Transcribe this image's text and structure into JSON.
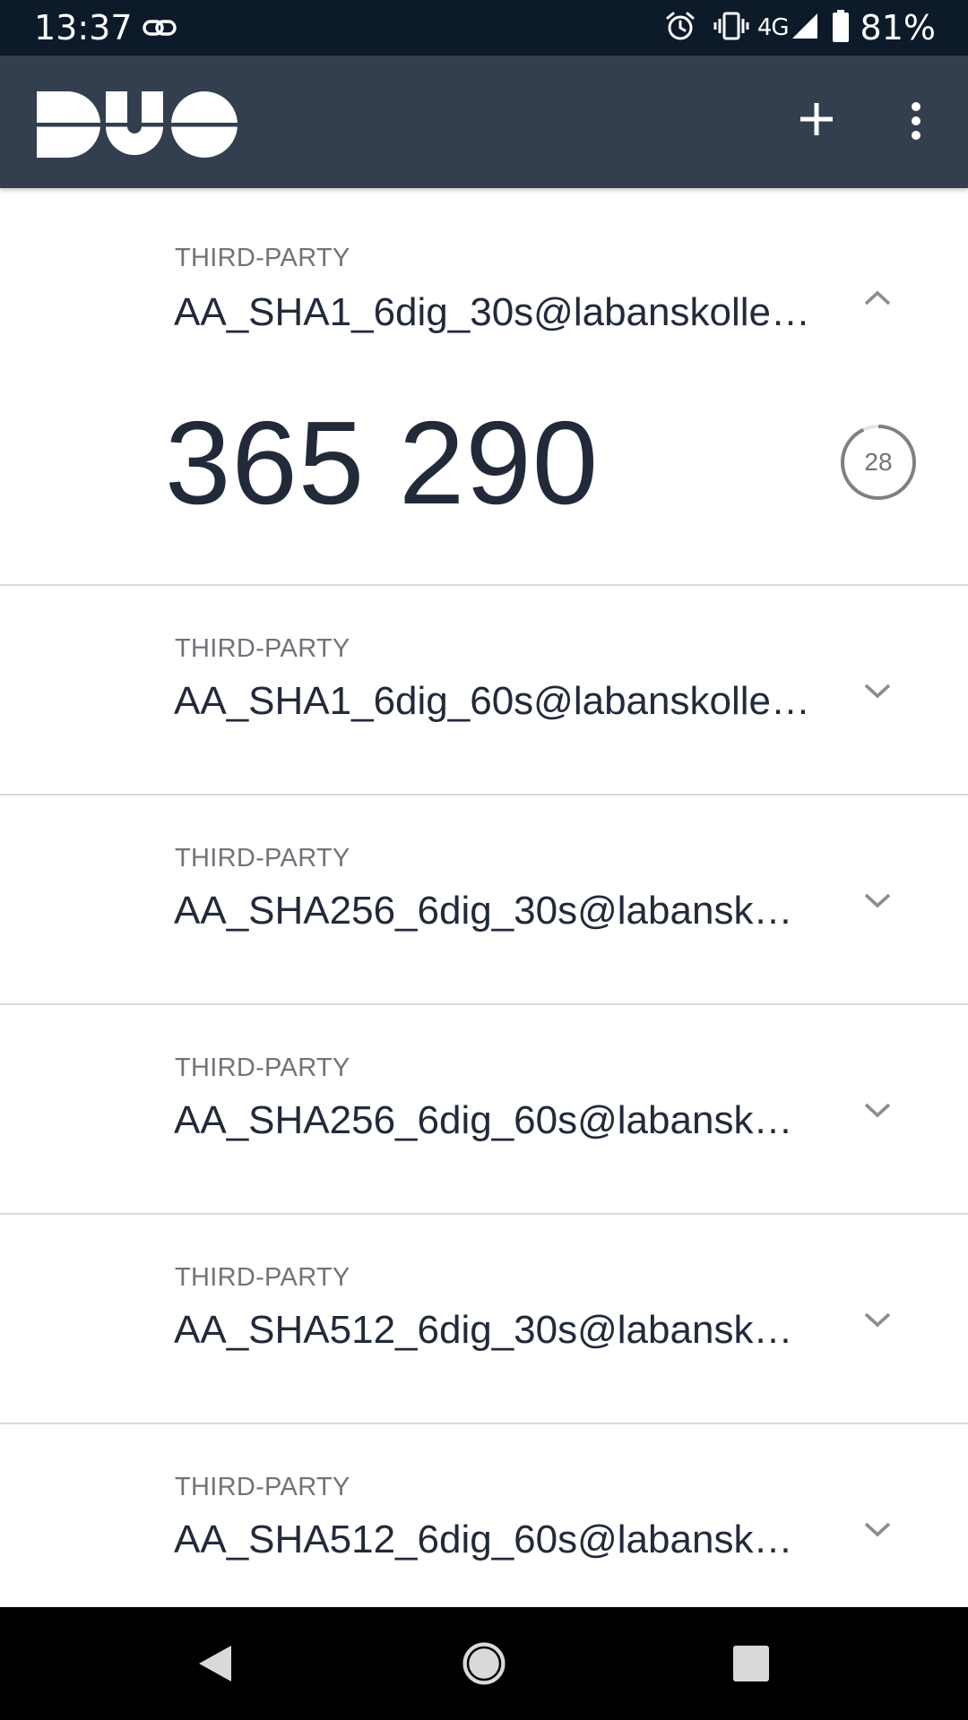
{
  "status_bar": {
    "time": "13:37",
    "network": "4G",
    "battery_percent": "81%",
    "icons": [
      "link-icon",
      "alarm-icon",
      "vibrate-icon",
      "signal-icon",
      "battery-icon"
    ]
  },
  "app_bar": {
    "logo": "DUO",
    "actions": [
      "add-icon",
      "more-vert-icon"
    ]
  },
  "accounts": [
    {
      "type": "THIRD-PARTY",
      "name": "AA_SHA1_6dig_30s@labanskolle…",
      "expanded": true,
      "passcode": "365 290",
      "seconds_remaining": "28",
      "timer_fraction": 0.93
    },
    {
      "type": "THIRD-PARTY",
      "name": "AA_SHA1_6dig_60s@labanskolle…",
      "expanded": false
    },
    {
      "type": "THIRD-PARTY",
      "name": "AA_SHA256_6dig_30s@labansk…",
      "expanded": false
    },
    {
      "type": "THIRD-PARTY",
      "name": "AA_SHA256_6dig_60s@labansk…",
      "expanded": false
    },
    {
      "type": "THIRD-PARTY",
      "name": "AA_SHA512_6dig_30s@labansk…",
      "expanded": false
    },
    {
      "type": "THIRD-PARTY",
      "name": "AA_SHA512_6dig_60s@labansk…",
      "expanded": false
    }
  ],
  "nav_bar": {
    "buttons": [
      "back-icon",
      "home-icon",
      "recents-icon"
    ]
  },
  "colors": {
    "status_bar": "#0c1a29",
    "app_bar": "#333f4f",
    "text_primary": "#222a3a",
    "text_secondary": "#6f7479",
    "divider": "#d8dadd"
  }
}
